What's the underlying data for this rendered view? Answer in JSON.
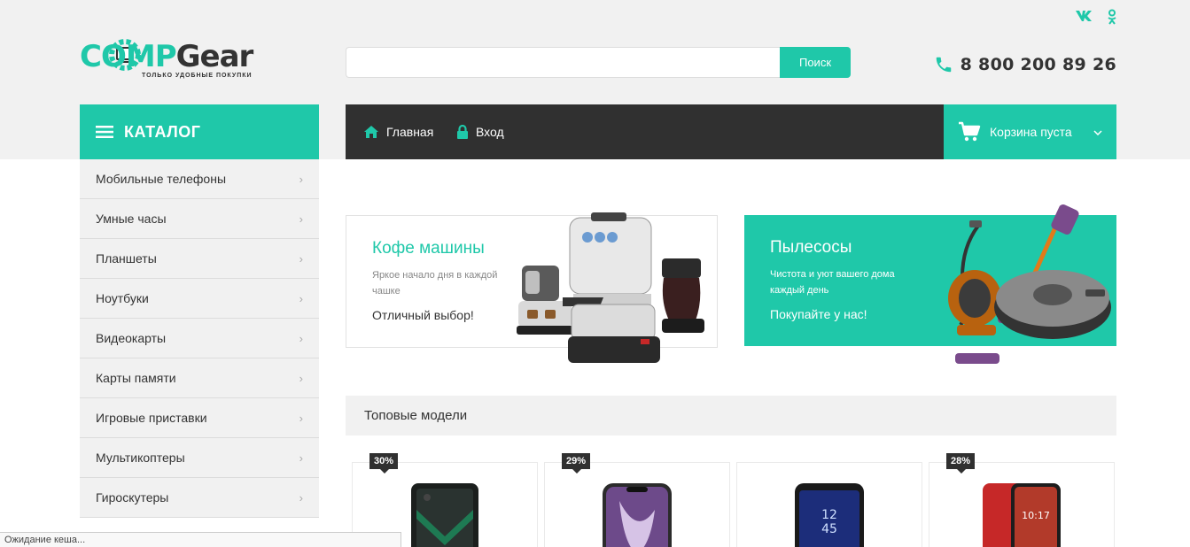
{
  "social": {
    "vk": "vk-icon",
    "ok": "odnoklassniki-icon"
  },
  "logo": {
    "part1": "COMP",
    "part2": "Gear",
    "tagline": "ТОЛЬКО УДОБНЫЕ ПОКУПКИ"
  },
  "search": {
    "value": "",
    "button": "Поиск"
  },
  "phone": {
    "number": "8 800 200 89 26"
  },
  "catalog": {
    "title": "КАТАЛОГ",
    "items": [
      {
        "label": "Мобильные телефоны"
      },
      {
        "label": "Умные часы"
      },
      {
        "label": "Планшеты"
      },
      {
        "label": "Ноутбуки"
      },
      {
        "label": "Видеокарты"
      },
      {
        "label": "Карты памяти"
      },
      {
        "label": "Игровые приставки"
      },
      {
        "label": "Мультикоптеры"
      },
      {
        "label": "Гироскутеры"
      }
    ]
  },
  "nav": {
    "home": "Главная",
    "login": "Вход",
    "cart": "Корзина пуста"
  },
  "banners": [
    {
      "title": "Кофе машины",
      "subtitle": "Яркое начало дня в каждой чашке",
      "cta": "Отличный выбор!"
    },
    {
      "title": "Пылесосы",
      "subtitle": "Чистота и уют вашего дома каждый день",
      "cta": "Покупайте у нас!"
    }
  ],
  "top_models": {
    "title": "Топовые модели",
    "products": [
      {
        "discount": "30%"
      },
      {
        "discount": "29%"
      },
      {
        "discount": ""
      },
      {
        "discount": "28%"
      }
    ]
  },
  "phone_screen_text": {
    "time": "12",
    "time2": "45",
    "clock": "10:17"
  },
  "status": "Ожидание кеша...",
  "colors": {
    "accent": "#1fc8a9",
    "dark": "#303030",
    "band": "#f1f1f1"
  }
}
